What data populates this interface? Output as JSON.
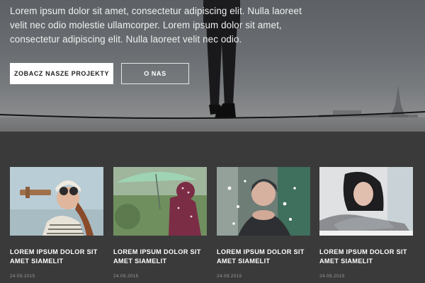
{
  "hero": {
    "text": "Lorem ipsum dolor sit amet, consectetur adipiscing elit. Nulla laoreet velit nec odio molestie ullamcorper. Lorem ipsum dolor sit amet, consectetur adipiscing elit. Nulla laoreet velit nec odio.",
    "primary_button": "ZOBACZ NASZE PROJEKTY",
    "secondary_button": "O NAS"
  },
  "projects": [
    {
      "title": "LOREM IPSUM DOLOR SIT AMET SIAMELIT",
      "date": "24.09.2015",
      "image": "child-aviator-photo"
    },
    {
      "title": "LOREM IPSUM DOLOR SIT AMET SIAMELIT",
      "date": "24.09.2015",
      "image": "child-umbrella-photo"
    },
    {
      "title": "LOREM IPSUM DOLOR SIT AMET SIAMELIT",
      "date": "24.09.2015",
      "image": "woman-blowing-snow-photo"
    },
    {
      "title": "LOREM IPSUM DOLOR SIT AMET SIAMELIT",
      "date": "24.09.2015",
      "image": "woman-resting-photo"
    }
  ],
  "colors": {
    "page_background": "#3a3a3a",
    "hero_text": "#f0f0f0",
    "button_primary_bg": "#ffffff",
    "card_title": "#ffffff",
    "card_date": "#9a9a9a"
  }
}
